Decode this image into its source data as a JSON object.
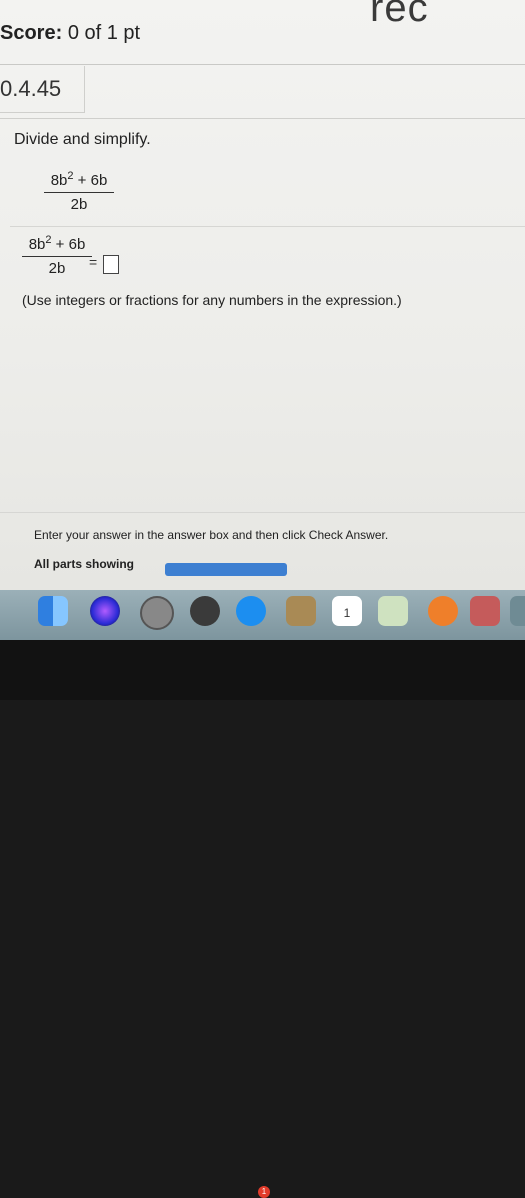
{
  "window": {
    "top_title_fragment": "rec"
  },
  "score": {
    "label": "Score:",
    "value": "0 of 1 pt"
  },
  "question": {
    "id": "0.4.45",
    "instruction": "Divide and simplify.",
    "expression": {
      "numerator_base": "8b",
      "exponent": "2",
      "numerator_rest": " + 6b",
      "denominator": "2b"
    },
    "answer_equals": "=",
    "answer_value": "",
    "hint": "(Use integers or fractions for any numbers in the expression.)"
  },
  "footer": {
    "enter_text": "Enter your answer in the answer box and then click Check Answer.",
    "parts_label": "All parts showing",
    "progress": 1.0
  },
  "dock": {
    "items": [
      {
        "icon": "finder-icon"
      },
      {
        "icon": "siri-icon"
      },
      {
        "icon": "system-preferences-icon"
      },
      {
        "icon": "launchpad-icon"
      },
      {
        "icon": "app-store-icon",
        "badge": "1"
      },
      {
        "icon": "notes-icon"
      },
      {
        "icon": "calendar-icon",
        "label": "1"
      },
      {
        "icon": "preview-icon"
      },
      {
        "icon": "books-icon"
      },
      {
        "icon": "photo-booth-icon"
      },
      {
        "icon": "app-icon"
      }
    ]
  }
}
